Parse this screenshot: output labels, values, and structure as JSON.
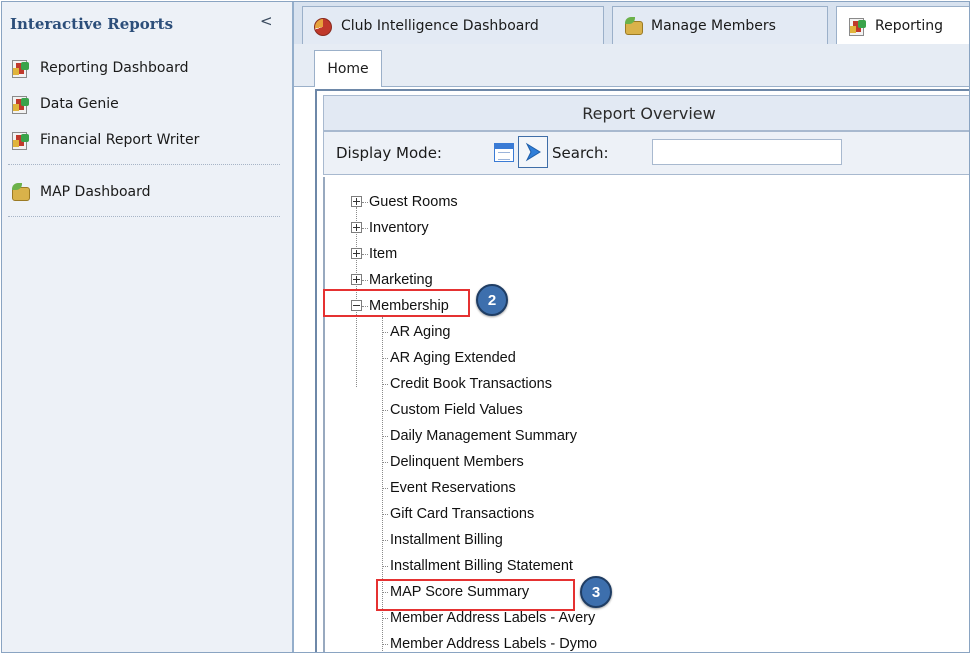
{
  "sidebar": {
    "title": "Interactive Reports",
    "collapse_glyph": "<",
    "items": [
      {
        "label": "Reporting Dashboard",
        "icon": "report-chart-icon"
      },
      {
        "label": "Data Genie",
        "icon": "report-chart-icon"
      },
      {
        "label": "Financial Report Writer",
        "icon": "report-chart-icon"
      },
      {
        "label": "MAP Dashboard",
        "icon": "money-bag-icon"
      }
    ]
  },
  "tabs": [
    {
      "label": "Club Intelligence Dashboard",
      "icon": "pie-chart-icon"
    },
    {
      "label": "Manage Members",
      "icon": "money-bag-icon"
    },
    {
      "label": "Reporting",
      "icon": "report-chart-icon"
    }
  ],
  "subtab": {
    "label": "Home"
  },
  "report": {
    "header": "Report Overview",
    "display_mode_label": "Display Mode:",
    "search_label": "Search:",
    "search_value": ""
  },
  "tree": {
    "top": [
      "Guest Rooms",
      "Inventory",
      "Item",
      "Marketing",
      "Membership"
    ],
    "membership_children": [
      "AR Aging",
      "AR Aging Extended",
      "Credit Book Transactions",
      "Custom Field Values",
      "Daily Management Summary",
      "Delinquent Members",
      "Event Reservations",
      "Gift Card Transactions",
      "Installment Billing",
      "Installment Billing Statement",
      "MAP Score Summary",
      "Member Address Labels - Avery",
      "Member Address Labels - Dymo"
    ]
  },
  "callouts": [
    "2",
    "3"
  ],
  "colors": {
    "highlight": "#e53131",
    "badge": "#3d6fad",
    "accent": "#2c4e7a"
  }
}
